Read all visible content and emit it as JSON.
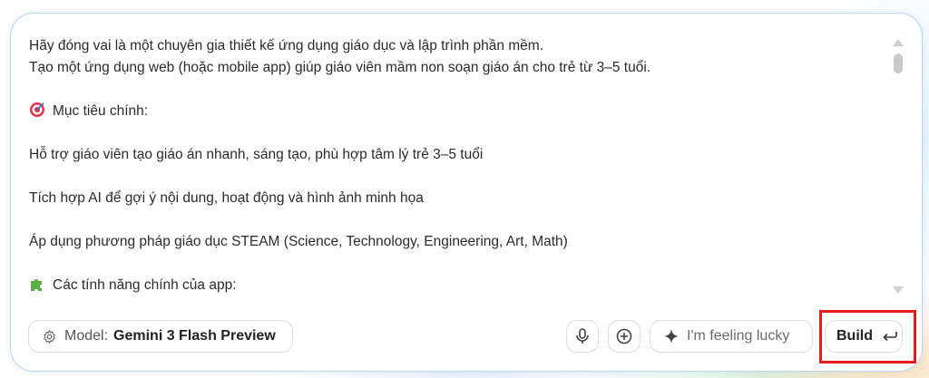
{
  "prompt": {
    "lines": [
      "Hãy đóng vai là một chuyên gia thiết kế ứng dụng giáo dục và lập trình phần mềm.",
      "Tạo một ứng dụng web (hoặc mobile app) giúp giáo viên mầm non soạn giáo án cho trẻ từ 3–5 tuổi.",
      "Mục tiêu chính:",
      "Hỗ trợ giáo viên tạo giáo án nhanh, sáng tạo, phù hợp tâm lý trẻ 3–5 tuổi",
      "Tích hợp AI để gợi ý nội dung, hoạt động và hình ảnh minh họa",
      "Áp dụng phương pháp giáo dục STEAM (Science, Technology, Engineering, Art, Math)",
      "Các tính năng chính của app:"
    ],
    "icons": [
      "target-emoji",
      "puzzle-emoji"
    ]
  },
  "toolbar": {
    "model_label": "Model:",
    "model_value": "Gemini 3 Flash Preview",
    "lucky_label": "I'm feeling lucky",
    "build_label": "Build",
    "build_key_icon": "return-arrow-icon"
  },
  "colors": {
    "card_border": "#b9d6f7",
    "highlight": "#e81b1b"
  }
}
